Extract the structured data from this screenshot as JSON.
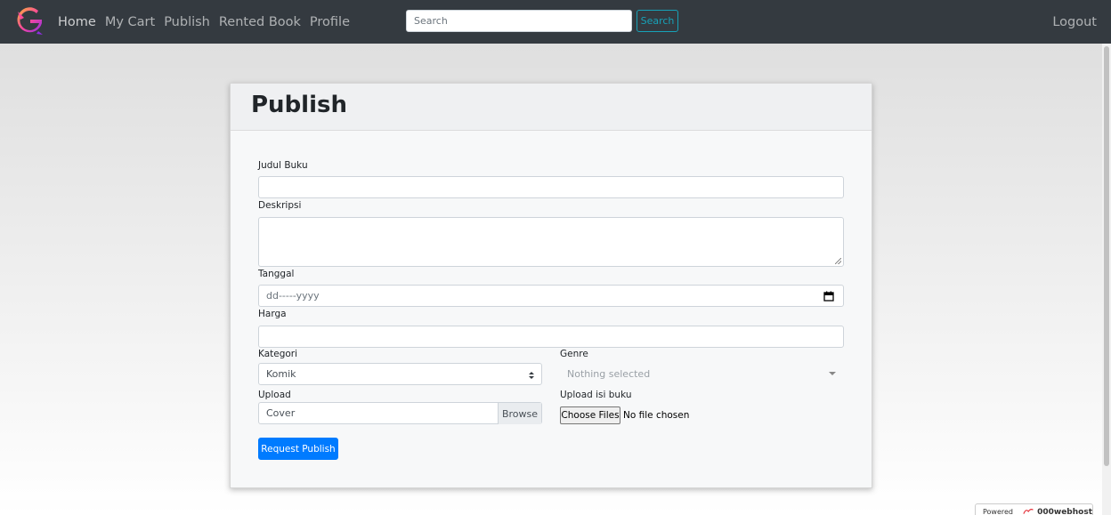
{
  "navbar": {
    "logo_icon": "g-logo-icon",
    "links": [
      "Home",
      "My Cart",
      "Publish",
      "Rented Book",
      "Profile"
    ],
    "search_placeholder": "Search",
    "search_button": "Search",
    "logout": "Logout"
  },
  "card": {
    "title": "Publish",
    "fields": {
      "judul_label": "Judul Buku",
      "judul_value": "",
      "deskripsi_label": "Deskripsi",
      "deskripsi_value": "",
      "tanggal_label": "Tanggal",
      "tanggal_placeholder": "dd-----yyyy",
      "harga_label": "Harga",
      "harga_value": "",
      "kategori_label": "Kategori",
      "kategori_selected": "Komik",
      "genre_label": "Genre",
      "genre_placeholder": "Nothing selected",
      "upload_label": "Upload",
      "upload_cover_text": "Cover",
      "upload_browse": "Browse",
      "upload_isi_label": "Upload isi buku",
      "choose_files": "Choose Files",
      "no_file": "No file chosen"
    },
    "submit": "Request Publish"
  },
  "footer_badge": {
    "prefix": "Powered by",
    "brand": "000webhost"
  },
  "colors": {
    "navbar_bg": "#343a40",
    "primary": "#007bff",
    "info": "#17a2b8"
  }
}
